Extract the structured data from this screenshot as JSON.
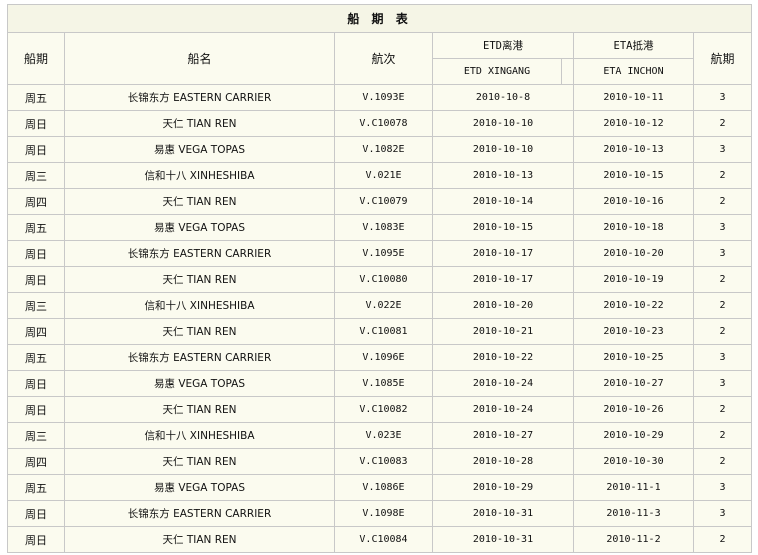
{
  "table": {
    "title": "船 期 表",
    "headers": {
      "day": "船期",
      "ship": "船名",
      "voyage": "航次",
      "etd": "ETD离港",
      "eta": "ETA抵港",
      "duration": "航期",
      "etd_sub": "ETD XINGANG",
      "eta_sub": "ETA INCHON"
    },
    "rows": [
      {
        "day": "周五",
        "ship": "长锦东方 EASTERN CARRIER",
        "voyage": "V.1093E",
        "etd": "2010-10-8",
        "eta": "2010-10-11",
        "duration": "3"
      },
      {
        "day": "周日",
        "ship": "天仁 TIAN REN",
        "voyage": "V.C10078",
        "etd": "2010-10-10",
        "eta": "2010-10-12",
        "duration": "2"
      },
      {
        "day": "周日",
        "ship": "易惠 VEGA TOPAS",
        "voyage": "V.1082E",
        "etd": "2010-10-10",
        "eta": "2010-10-13",
        "duration": "3"
      },
      {
        "day": "周三",
        "ship": "信和十八 XINHESHIBA",
        "voyage": "V.021E",
        "etd": "2010-10-13",
        "eta": "2010-10-15",
        "duration": "2"
      },
      {
        "day": "周四",
        "ship": "天仁 TIAN REN",
        "voyage": "V.C10079",
        "etd": "2010-10-14",
        "eta": "2010-10-16",
        "duration": "2"
      },
      {
        "day": "周五",
        "ship": "易惠 VEGA TOPAS",
        "voyage": "V.1083E",
        "etd": "2010-10-15",
        "eta": "2010-10-18",
        "duration": "3"
      },
      {
        "day": "周日",
        "ship": "长锦东方 EASTERN CARRIER",
        "voyage": "V.1095E",
        "etd": "2010-10-17",
        "eta": "2010-10-20",
        "duration": "3"
      },
      {
        "day": "周日",
        "ship": "天仁 TIAN REN",
        "voyage": "V.C10080",
        "etd": "2010-10-17",
        "eta": "2010-10-19",
        "duration": "2"
      },
      {
        "day": "周三",
        "ship": "信和十八 XINHESHIBA",
        "voyage": "V.022E",
        "etd": "2010-10-20",
        "eta": "2010-10-22",
        "duration": "2"
      },
      {
        "day": "周四",
        "ship": "天仁 TIAN REN",
        "voyage": "V.C10081",
        "etd": "2010-10-21",
        "eta": "2010-10-23",
        "duration": "2"
      },
      {
        "day": "周五",
        "ship": "长锦东方 EASTERN CARRIER",
        "voyage": "V.1096E",
        "etd": "2010-10-22",
        "eta": "2010-10-25",
        "duration": "3"
      },
      {
        "day": "周日",
        "ship": "易惠 VEGA TOPAS",
        "voyage": "V.1085E",
        "etd": "2010-10-24",
        "eta": "2010-10-27",
        "duration": "3"
      },
      {
        "day": "周日",
        "ship": "天仁 TIAN REN",
        "voyage": "V.C10082",
        "etd": "2010-10-24",
        "eta": "2010-10-26",
        "duration": "2"
      },
      {
        "day": "周三",
        "ship": "信和十八 XINHESHIBA",
        "voyage": "V.023E",
        "etd": "2010-10-27",
        "eta": "2010-10-29",
        "duration": "2"
      },
      {
        "day": "周四",
        "ship": "天仁 TIAN REN",
        "voyage": "V.C10083",
        "etd": "2010-10-28",
        "eta": "2010-10-30",
        "duration": "2"
      },
      {
        "day": "周五",
        "ship": "易惠 VEGA TOPAS",
        "voyage": "V.1086E",
        "etd": "2010-10-29",
        "eta": "2010-11-1",
        "duration": "3"
      },
      {
        "day": "周日",
        "ship": "长锦东方 EASTERN CARRIER",
        "voyage": "V.1098E",
        "etd": "2010-10-31",
        "eta": "2010-11-3",
        "duration": "3"
      },
      {
        "day": "周日",
        "ship": "天仁 TIAN REN",
        "voyage": "V.C10084",
        "etd": "2010-10-31",
        "eta": "2010-11-2",
        "duration": "2"
      }
    ]
  },
  "colors": {
    "background": "#fbfbef",
    "border": "#c8c8c8"
  }
}
